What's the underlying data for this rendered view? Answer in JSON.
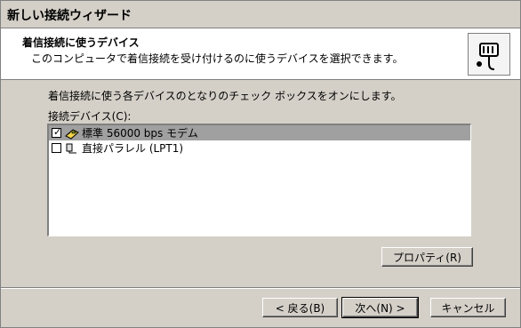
{
  "window": {
    "title": "新しい接続ウィザード"
  },
  "header": {
    "title": "着信接続に使うデバイス",
    "subtitle": "このコンピュータで着信接続を受け付けるのに使うデバイスを選択できます。",
    "icon": "plug-icon"
  },
  "instructions": "着信接続に使う各デバイスのとなりのチェック ボックスをオンにします。",
  "devices": {
    "label": "接続デバイス(C):",
    "items": [
      {
        "label": "標準 56000 bps モデム",
        "checked": true,
        "selected": true,
        "icon": "modem-icon"
      },
      {
        "label": "直接パラレル (LPT1)",
        "checked": false,
        "selected": false,
        "icon": "parallel-cable-icon"
      }
    ]
  },
  "buttons": {
    "properties": "プロパティ(R)",
    "back": "< 戻る(B)",
    "next": "次へ(N) >",
    "cancel": "キャンセル"
  }
}
